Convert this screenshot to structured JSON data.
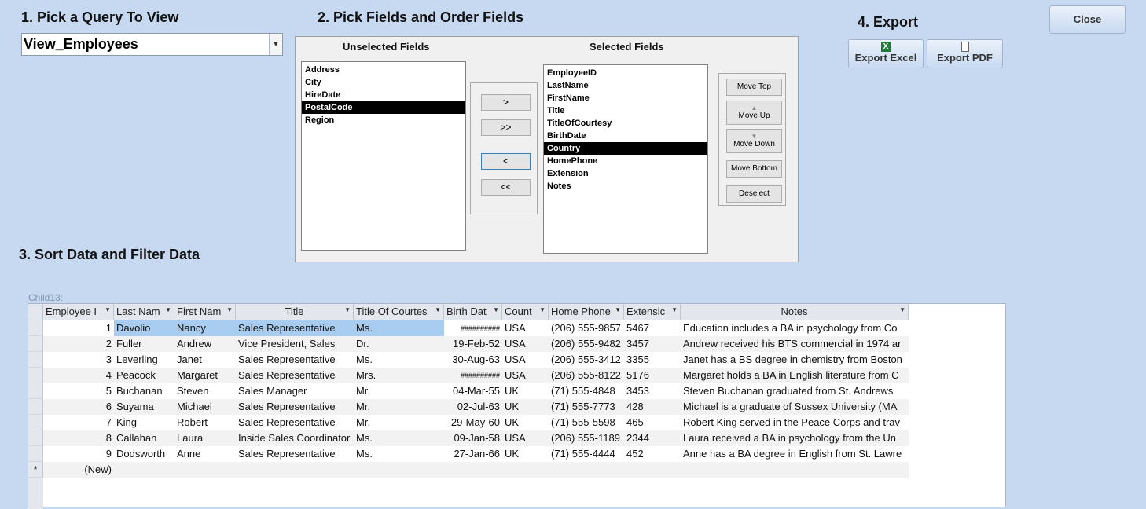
{
  "section1": {
    "title": "1. Pick a Query To View",
    "query_value": "View_Employees"
  },
  "section2": {
    "title": "2. Pick Fields and Order Fields",
    "unselected_label": "Unselected Fields",
    "selected_label": "Selected Fields",
    "unselected": [
      "Address",
      "City",
      "HireDate",
      "PostalCode",
      "Region"
    ],
    "unselected_selected": "PostalCode",
    "selected": [
      "EmployeeID",
      "LastName",
      "FirstName",
      "Title",
      "TitleOfCourtesy",
      "BirthDate",
      "Country",
      "HomePhone",
      "Extension",
      "Notes"
    ],
    "selected_selected": "Country",
    "transfer": {
      "add": ">",
      "add_all": ">>",
      "remove": "<",
      "remove_all": "<<"
    },
    "order": {
      "top": "Move Top",
      "up": "Move Up",
      "down": "Move Down",
      "bottom": "Move Bottom",
      "deselect": "Deselect"
    }
  },
  "section3": {
    "title": "3. Sort Data and Filter Data",
    "subform_label": "Child13:"
  },
  "section4": {
    "title": "4. Export",
    "excel": "Export Excel",
    "pdf": "Export PDF"
  },
  "close": "Close",
  "grid": {
    "columns": [
      "Employee I",
      "Last Nam",
      "First Nam",
      "Title",
      "Title Of Courtes",
      "Birth Dat",
      "Count",
      "Home Phone",
      "Extensic",
      "Notes"
    ],
    "rows": [
      [
        "1",
        "Davolio",
        "Nancy",
        "Sales Representative",
        "Ms.",
        "##########",
        "USA",
        "(206) 555-9857",
        "5467",
        "Education includes a BA in psychology from Co"
      ],
      [
        "2",
        "Fuller",
        "Andrew",
        "Vice President, Sales",
        "Dr.",
        "19-Feb-52",
        "USA",
        "(206) 555-9482",
        "3457",
        "Andrew received his BTS commercial in 1974 ar"
      ],
      [
        "3",
        "Leverling",
        "Janet",
        "Sales Representative",
        "Ms.",
        "30-Aug-63",
        "USA",
        "(206) 555-3412",
        "3355",
        "Janet has a BS degree in chemistry from Boston"
      ],
      [
        "4",
        "Peacock",
        "Margaret",
        "Sales Representative",
        "Mrs.",
        "##########",
        "USA",
        "(206) 555-8122",
        "5176",
        "Margaret holds a BA in English literature from C"
      ],
      [
        "5",
        "Buchanan",
        "Steven",
        "Sales Manager",
        "Mr.",
        "04-Mar-55",
        "UK",
        "(71) 555-4848",
        "3453",
        "Steven Buchanan graduated from St. Andrews"
      ],
      [
        "6",
        "Suyama",
        "Michael",
        "Sales Representative",
        "Mr.",
        "02-Jul-63",
        "UK",
        "(71) 555-7773",
        "428",
        "Michael is a graduate of Sussex University (MA"
      ],
      [
        "7",
        "King",
        "Robert",
        "Sales Representative",
        "Mr.",
        "29-May-60",
        "UK",
        "(71) 555-5598",
        "465",
        "Robert King served in the Peace Corps and trav"
      ],
      [
        "8",
        "Callahan",
        "Laura",
        "Inside Sales Coordinator",
        "Ms.",
        "09-Jan-58",
        "USA",
        "(206) 555-1189",
        "2344",
        "Laura received a BA in psychology from the Un"
      ],
      [
        "9",
        "Dodsworth",
        "Anne",
        "Sales Representative",
        "Ms.",
        "27-Jan-66",
        "UK",
        "(71) 555-4444",
        "452",
        "Anne has a BA degree in English from St. Lawre"
      ]
    ],
    "new_row": "(New)",
    "new_marker": "*"
  }
}
